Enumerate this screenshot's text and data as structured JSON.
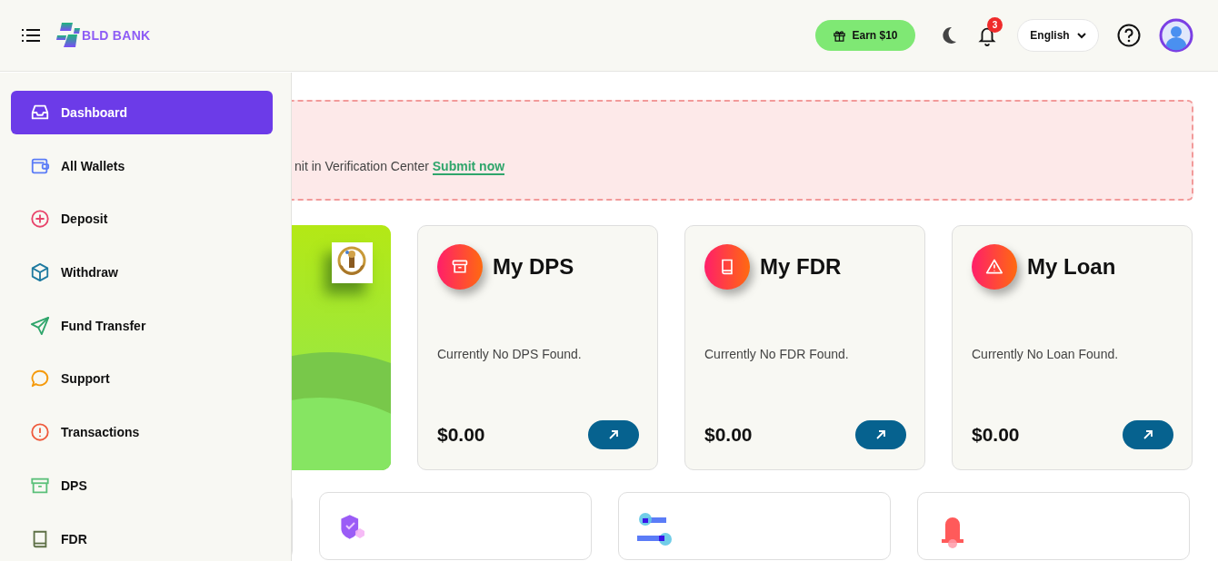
{
  "header": {
    "logo_text": "BLD BANK",
    "earn_button": "Earn $10",
    "notification_count": "3",
    "language": "English"
  },
  "sidebar": {
    "items": [
      {
        "label": "Dashboard",
        "selected": true
      },
      {
        "label": "All Wallets",
        "selected": false
      },
      {
        "label": "Deposit",
        "selected": false
      },
      {
        "label": "Withdraw",
        "selected": false
      },
      {
        "label": "Fund Transfer",
        "selected": false
      },
      {
        "label": "Support",
        "selected": false
      },
      {
        "label": "Transactions",
        "selected": false
      },
      {
        "label": "DPS",
        "selected": false
      },
      {
        "label": "FDR",
        "selected": false
      }
    ]
  },
  "alert": {
    "text": "nit in Verification Center",
    "link": "Submit now"
  },
  "summary_cards": [
    {
      "title": "My DPS",
      "note": "Currently No DPS Found.",
      "amount": "$0.00"
    },
    {
      "title": "My FDR",
      "note": "Currently No FDR Found.",
      "amount": "$0.00"
    },
    {
      "title": "My Loan",
      "note": "Currently No Loan Found.",
      "amount": "$0.00"
    }
  ]
}
